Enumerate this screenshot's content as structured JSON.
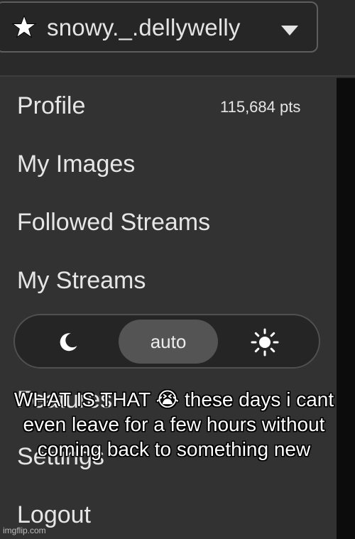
{
  "header": {
    "username": "snowy._.dellywelly",
    "user_icon": "star-icon",
    "dropdown_icon": "caret-down-icon"
  },
  "menu": {
    "profile_label": "Profile",
    "points": "115,684 pts",
    "my_images_label": "My Images",
    "followed_streams_label": "Followed Streams",
    "my_streams_label": "My Streams",
    "features_label": "Features",
    "settings_label": "Settings",
    "logout_label": "Logout"
  },
  "theme_toggle": {
    "dark_icon": "moon-icon",
    "auto_label": "auto",
    "light_icon": "sun-icon",
    "selected": "auto"
  },
  "caption": {
    "text": "WHAT IS THAT 😭 these days i cant even leave for a few hours without coming back to something new"
  },
  "watermark": {
    "text": "imgflip.com"
  },
  "colors": {
    "background": "#2b2b2b",
    "menu_background": "#323232",
    "text": "#e6e6e6",
    "toggle_active": "#545454"
  }
}
